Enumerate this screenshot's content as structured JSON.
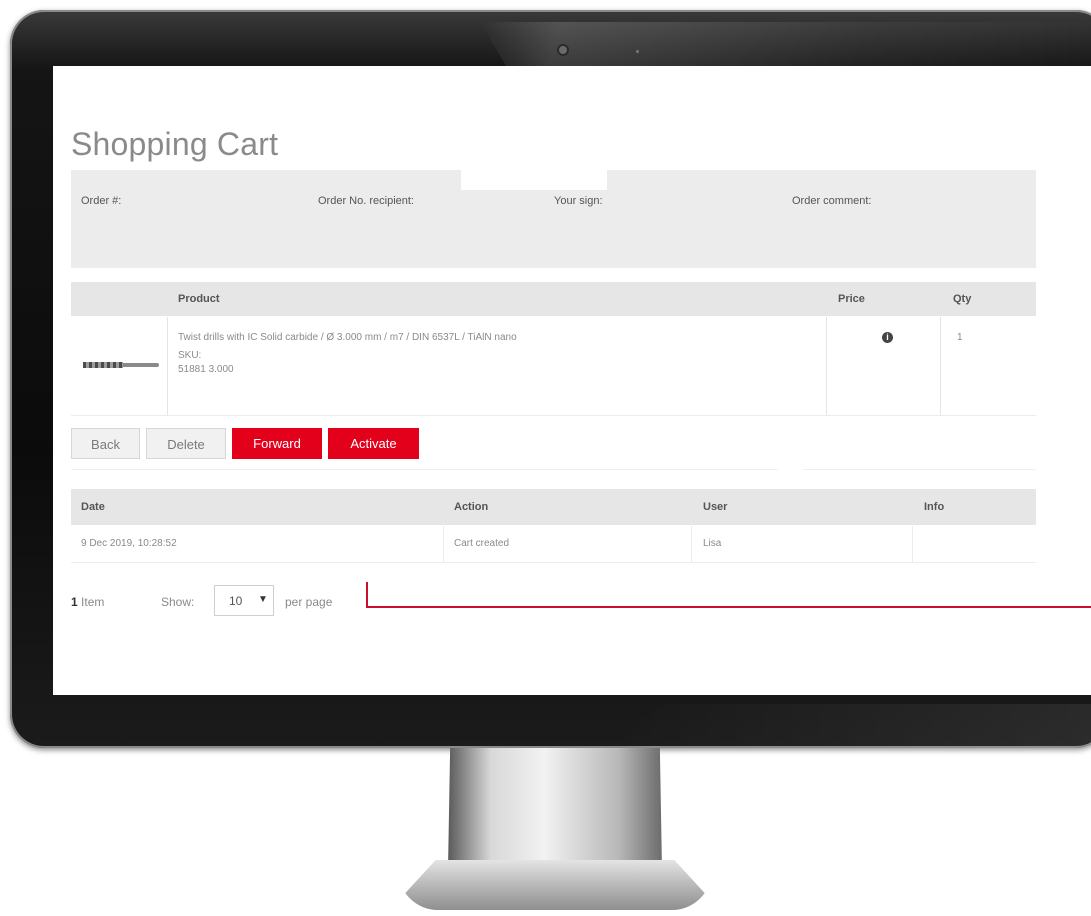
{
  "page": {
    "title": "Shopping Cart"
  },
  "order": {
    "order_no_label": "Order #:",
    "recipient_label": "Order No. recipient:",
    "your_sign_label": "Your sign:",
    "comment_label": "Order comment:"
  },
  "products": {
    "headers": {
      "product": "Product",
      "price": "Price",
      "qty": "Qty"
    },
    "row": {
      "description": "Twist drills with IC Solid carbide / Ø 3.000 mm / m7 / DIN 6537L / TiAlN nano",
      "sku_label": "SKU:",
      "sku_value": "51881 3.000",
      "qty": "1",
      "price_icon": "info-icon"
    }
  },
  "buttons": {
    "back": "Back",
    "delete": "Delete",
    "forward": "Forward",
    "activate": "Activate"
  },
  "history": {
    "headers": {
      "date": "Date",
      "action": "Action",
      "user": "User",
      "info": "Info"
    },
    "row": {
      "date": "9 Dec 2019, 10:28:52",
      "action": "Cart created",
      "user": "Lisa",
      "info": ""
    }
  },
  "pagination": {
    "count": "1",
    "count_suffix": "Item",
    "show_label": "Show:",
    "per_page_value": "10",
    "per_page_label": "per page"
  },
  "colors": {
    "accent_red": "#e3001b",
    "callout_red": "#c8102e"
  }
}
